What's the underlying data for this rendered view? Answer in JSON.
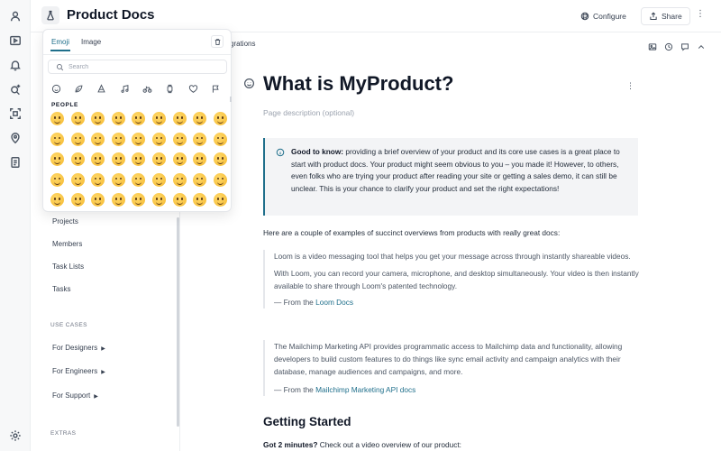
{
  "header": {
    "title": "Product Docs",
    "configure_label": "Configure",
    "share_label": "Share",
    "more": "⋮"
  },
  "subbar": {
    "breadcrumb": "grations"
  },
  "emoji_picker": {
    "tab_emoji": "Emoji",
    "tab_image": "Image",
    "search_placeholder": "Search",
    "section_label": "PEOPLE",
    "emoji_count": 45
  },
  "sidebar": {
    "items": [
      "Projects",
      "Members",
      "Task Lists",
      "Tasks"
    ],
    "use_cases_label": "USE CASES",
    "use_cases": [
      "For Designers",
      "For Engineers",
      "For Support"
    ],
    "extras_label": "EXTRAS"
  },
  "page": {
    "title": "What is MyProduct?",
    "description_placeholder": "Page description (optional)",
    "more": "⋮",
    "hint_bold": "Good to know:",
    "hint_text": " providing a brief overview of your product and its core use cases is a great place to start with product docs. Your product might seem obvious to you – you made it! However, to others, even folks who are trying your product after reading your site or getting a sales demo, it can still be unclear. This is your chance to clarify your product and set the right expectations!",
    "intro": "Here are a couple of examples of succinct overviews from products with really great docs:",
    "quote1_p1": "Loom is a video messaging tool that helps you get your message across through instantly shareable videos.",
    "quote1_p2": "With Loom, you can record your camera, microphone, and desktop simultaneously. Your video is then instantly available to share through Loom's patented technology.",
    "quote1_src": "— From the ",
    "quote1_link": "Loom Docs",
    "quote2_p1": "The Mailchimp Marketing API provides programmatic access to Mailchimp data and functionality, allowing developers to build custom features to do things like sync email activity and campaign analytics with their database, manage audiences and campaigns, and more.",
    "quote2_src": "— From the ",
    "quote2_link": "Mailchimp Marketing API docs",
    "h2": "Getting Started",
    "gs_bold": "Got 2 minutes?",
    "gs_text": " Check out a video overview of our product:"
  },
  "colors": {
    "accent": "#1f6f8b",
    "rail_bg": "#f7f8f9",
    "hint_bg": "#f3f4f6"
  }
}
